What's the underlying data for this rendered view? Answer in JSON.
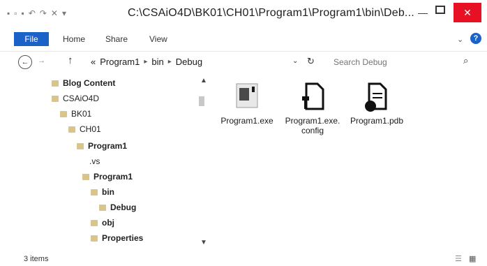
{
  "window": {
    "title": "C:\\CSAiO4D\\BK01\\CH01\\Program1\\Program1\\bin\\Deb...",
    "minimize": "—",
    "close": "✕"
  },
  "ribbon": {
    "tabs": [
      "File",
      "Home",
      "Share",
      "View"
    ],
    "expand": "⌄",
    "help": "?"
  },
  "address": {
    "back": "←",
    "forward": "→",
    "up": "↑",
    "overflow": "«",
    "crumbs": [
      "Program1",
      "bin",
      "Debug"
    ],
    "dropdown": "⌄",
    "refresh": "↻",
    "search_placeholder": "Search Debug"
  },
  "nav": {
    "items": [
      {
        "label": "Blog Content"
      },
      {
        "label": "CSAiO4D"
      },
      {
        "label": "BK01"
      },
      {
        "label": "CH01"
      },
      {
        "label": "Program1"
      },
      {
        "label": ".vs"
      },
      {
        "label": "Program1"
      },
      {
        "label": "bin"
      },
      {
        "label": "Debug"
      },
      {
        "label": "obj"
      },
      {
        "label": "Properties"
      }
    ]
  },
  "files": [
    {
      "name": "Program1.exe",
      "icon": "exe-icon"
    },
    {
      "name": "Program1.exe.config",
      "icon": "config-icon"
    },
    {
      "name": "Program1.pdb",
      "icon": "pdb-icon"
    }
  ],
  "status": {
    "items": "3 items"
  }
}
